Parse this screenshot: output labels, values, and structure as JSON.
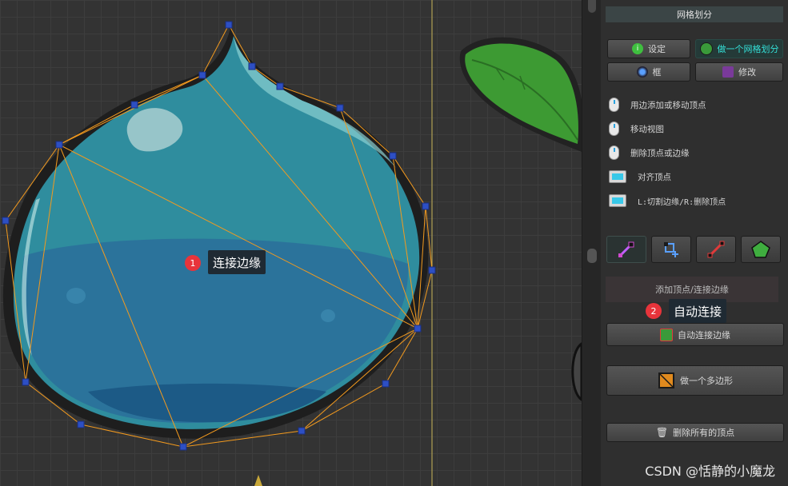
{
  "panel": {
    "title": "网格划分",
    "buttons": {
      "settings": "设定",
      "make_mesh": "做一个网格划分",
      "frame": "框",
      "modify": "修改"
    },
    "hints": [
      {
        "icon": "mouse-left-icon",
        "text": "用边添加或移动顶点"
      },
      {
        "icon": "mouse-middle-icon",
        "text": "移动视图"
      },
      {
        "icon": "mouse-right-icon",
        "text": "删除顶点或边缘"
      },
      {
        "icon": "keyboard-key-icon",
        "text": "对齐顶点"
      },
      {
        "icon": "keyboard-shift-icon",
        "text": "L:切割边缘/R:删除顶点"
      }
    ],
    "tools": [
      "add-vertex-tool-icon",
      "select-vertex-tool-icon",
      "edge-tool-icon",
      "polygon-tool-icon"
    ],
    "mode_label": "添加顶点/连接边缘",
    "auto_connect_label": "自动连接边缘",
    "make_polygon_label": "做一个多边形",
    "delete_all_label": "删除所有的顶点"
  },
  "annotations": {
    "tip1": {
      "badge": "1",
      "text": "连接边缘"
    },
    "tip2": {
      "badge": "2",
      "text": "自动连接"
    }
  },
  "watermark": "CSDN @恬静的小魔龙",
  "colors": {
    "accent_cyan": "#34e0d8",
    "edge_orange": "#f39a1e",
    "vertex_blue": "#2d4fc4",
    "badge_red": "#e8343b"
  }
}
